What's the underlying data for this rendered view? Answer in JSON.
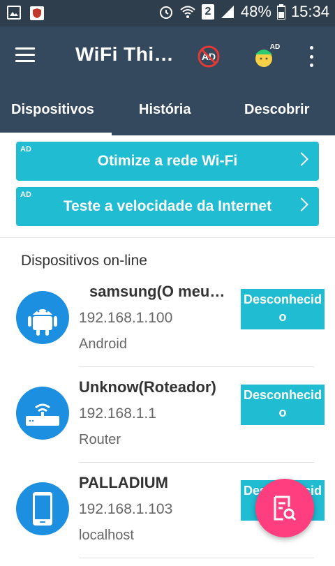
{
  "status_bar": {
    "sim_badge": "2",
    "battery_percent": "48%",
    "time": "15:34"
  },
  "toolbar": {
    "title": "WiFi Thi…",
    "ad_badge": "AD",
    "mascot_ad_tag": "AD"
  },
  "tabs": [
    {
      "label": "Dispositivos",
      "active": true
    },
    {
      "label": "História",
      "active": false
    },
    {
      "label": "Descobrir",
      "active": false
    }
  ],
  "ads": [
    {
      "tag": "AD",
      "label": "Otimize a rede Wi-Fi"
    },
    {
      "tag": "AD",
      "label": "Teste a velocidade da Internet"
    }
  ],
  "section": {
    "title": "Dispositivos on-line"
  },
  "devices": [
    {
      "name": "samsung(O meu…",
      "ip": "192.168.1.100",
      "type": "Android",
      "status_line1": "Desconhecid",
      "status_line2": "o",
      "icon": "android-icon"
    },
    {
      "name": "Unknow(Roteador)",
      "ip": "192.168.1.1",
      "type": "Router",
      "status_line1": "Desconhecid",
      "status_line2": "o",
      "icon": "router-icon"
    },
    {
      "name": "PALLADIUM",
      "ip": "192.168.1.103",
      "type": "localhost",
      "status_line1": "Desconhecid",
      "status_line2": "o",
      "icon": "phone-icon"
    }
  ],
  "colors": {
    "header": "#34495e",
    "accent": "#1fbcd2",
    "fab": "#ff3e7f",
    "avatar": "#1c8fe0"
  }
}
